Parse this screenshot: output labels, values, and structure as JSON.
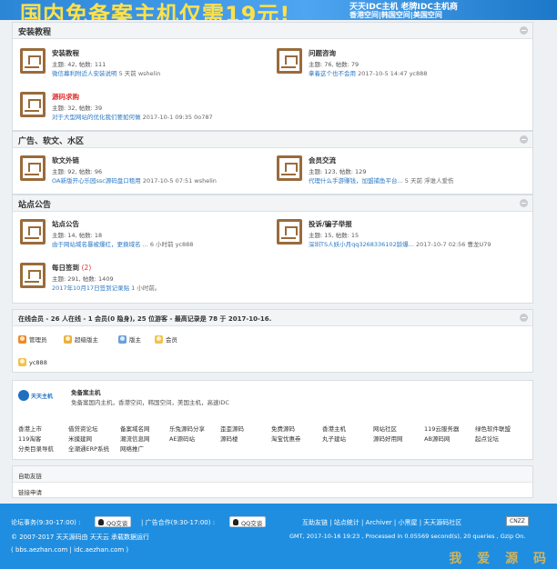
{
  "banner": {
    "headline": "国内免备案主机仅需19元!",
    "line1": "天天IDC主机 老牌IDC主机商",
    "line2": "香港空间|韩国空间|美国空间"
  },
  "sections": [
    {
      "title": "安装教程",
      "forums": [
        {
          "name": "安装教程",
          "stats": "主题: 42, 帖数: 111",
          "last_link": "微信幕利附近人安装说明",
          "last_meta": "5 天前 wshelin"
        },
        {
          "name": "问题咨询",
          "stats": "主题: 76, 帖数: 79",
          "last_link": "拿着这个也不会用",
          "last_meta": "2017-10-5 14:47 yc888"
        },
        {
          "name": "源码求购",
          "stats": "主题: 32, 帖数: 39",
          "last_link": "对于大型网站的优化我们要如何做",
          "last_meta": "2017-10-1 09:35 0o787"
        }
      ]
    },
    {
      "title": "广告、软文、水区",
      "forums": [
        {
          "name": "软文外链",
          "stats": "主题: 92, 帖数: 96",
          "last_link": "OA新版开心乐园ssc源码盘口租用",
          "last_meta": "2017-10-5 07:51 wshelin"
        },
        {
          "name": "会员交流",
          "stats": "主题: 123, 帖数: 129",
          "last_link": "代理什么手游赚钱，加盟捕鱼平台...",
          "last_meta": "5 天前 浮谁人爱伤"
        }
      ]
    },
    {
      "title": "站点公告",
      "forums": [
        {
          "name": "站点公告",
          "stats": "主题: 14, 帖数: 18",
          "last_link": "由于网站域名暴被爆红，更换域名 ...",
          "last_meta": "6 小时前 yc888"
        },
        {
          "name": "投诉/骗子举报",
          "stats": "主题: 15, 帖数: 15",
          "last_link": "深圳TS人妖小月qq3268336102龄爆...",
          "last_meta": "2017-10-7 02:56 曹龙U79"
        },
        {
          "name": "每日签到",
          "name_count": "(2)",
          "stats": "主题: 291, 帖数: 1409",
          "last_link": "2017年10月17日签到记录贴",
          "last_meta": "1 小时前。"
        }
      ]
    }
  ],
  "online": {
    "summary": "在线会员 - 26 人在线 - 1 会员(0 隐身), 25 位游客 - 最高记录是 78 于 2017-10-16.",
    "legend": [
      "管理员",
      "超级版主",
      "版主",
      "会员"
    ],
    "legend_colors": [
      "#f08a24",
      "#e8b23a",
      "#6aa0d8",
      "#f2c24a"
    ],
    "members": [
      "yc888"
    ]
  },
  "sponsor": {
    "logo_text": "天天主机",
    "title": "免备案主机",
    "desc": "免备案国内主机，香港空间，韩国空间，美国主机，高速IDC"
  },
  "partner_links": [
    [
      "香港上市",
      "借贷资论坛",
      "备案域名网",
      "乐兔源码分享",
      "歪歪源码",
      "免费源码",
      "香港主机",
      "网站社区",
      "119云服务器",
      "绿色软件联盟"
    ],
    [
      "119淘客",
      "米摸建网",
      "潮流信息网",
      "AE源码站",
      "源码楼",
      "淘宝优惠券",
      "丸子建站",
      "源码好用网",
      "AB源码网",
      "起点论坛"
    ],
    [
      "分类目录导航",
      "全潮通ERP系统",
      "网络推广"
    ]
  ],
  "friends": {
    "title": "自助友链",
    "apply": "链接申请"
  },
  "footer": {
    "sale_label": "论坛事务(9:30-17:00) :",
    "qq1": "QQ交谈",
    "ad_label": "| 广告合作(9:30-17:00) :",
    "qq2": "QQ交谈",
    "copyright": "© 2007-2017 天天源码由 天天云 承载数据运行",
    "domains": "( bbs.aezhan.com | idc.aezhan.com )",
    "nav": "互助友链 | 站点统计 | Archiver | 小黑屋 | 天天源码社区",
    "badge": "CNZZ",
    "gmt": "GMT, 2017-10-16 19:23 , Processed in 0.05569 second(s), 20 queries , Gzip On.",
    "watermark": "我 爱 源 码"
  }
}
